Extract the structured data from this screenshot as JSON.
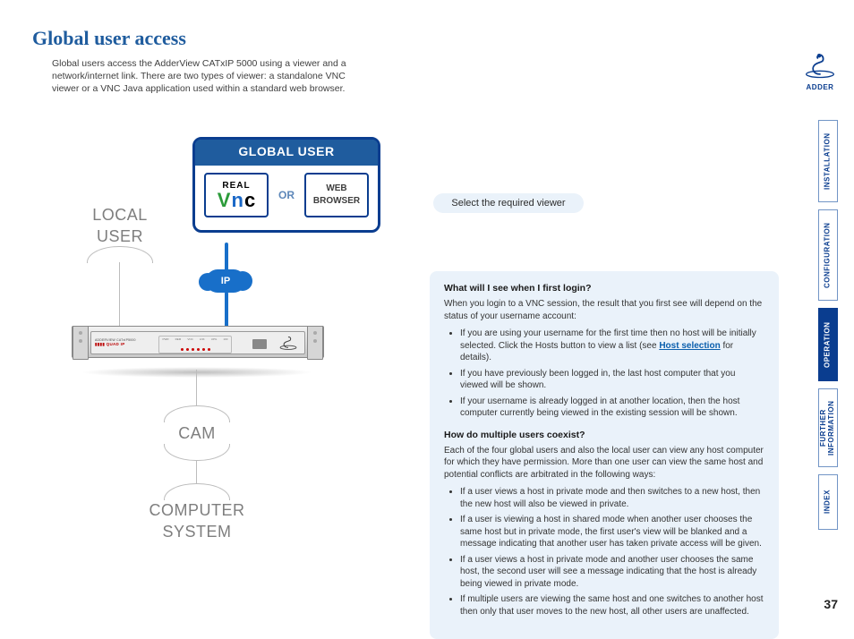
{
  "page_number": "37",
  "brand": "ADDER",
  "title": "Global user access",
  "intro": "Global users access the AdderView CATxIP 5000 using a viewer and a network/internet link. There are two types of viewer: a standalone VNC viewer or a VNC Java application used within a standard web browser.",
  "viewer_hint": "Select the required viewer",
  "diagram": {
    "global_user_title": "GLOBAL USER",
    "or_label": "OR",
    "vnc_real": "REAL",
    "web_browser_l1": "WEB",
    "web_browser_l2": "BROWSER",
    "ip_label": "IP",
    "local_user_l1": "LOCAL",
    "local_user_l2": "USER",
    "cam_label": "CAM",
    "computer_system_l1": "COMPUTER",
    "computer_system_l2": "SYSTEM",
    "device_leds": [
      "PWR",
      "REM",
      "VNC",
      "LNK",
      "UPG",
      "100"
    ],
    "device_quad": "QUAD IP",
    "device_model": "ADDERVIEW CATxIP5000"
  },
  "info": {
    "q1_title": "What will I see when I first login?",
    "q1_lead": "When you login to a VNC session, the result that you first see will depend on the status of your username account:",
    "q1_bullets": [
      {
        "pre": "If you are using your username for the first time then no host will be initially selected. Click the Hosts button to view a list (see ",
        "link": "Host selection",
        "post": " for details)."
      },
      {
        "text": "If you have previously been logged in, the last host computer that you viewed will be shown."
      },
      {
        "text": "If your username is already logged in at another location, then the host computer currently being viewed in the existing session will be shown."
      }
    ],
    "q2_title": "How do multiple users coexist?",
    "q2_lead": "Each of the four global users and also the local user can view any host computer for which they have permission. More than one user can view the same host and potential conflicts are arbitrated in the following ways:",
    "q2_bullets": [
      "If a user views a host in private mode and then switches to a new host, then the new host will also be viewed in private.",
      "If a user is viewing a host in shared mode when another user chooses the same host but in private mode, the first user's view will be blanked and a message indicating that another user has taken private access will be given.",
      "If a user views a host in private mode and another user chooses the same host, the second user will see a message indicating that the host is already being viewed in private mode.",
      "If multiple users are viewing the same host and one switches to another host then only that user moves to the new host, all other users are unaffected."
    ]
  },
  "nav": {
    "installation": "INSTALLATION",
    "configuration": "CONFIGURATION",
    "operation": "OPERATION",
    "further_l1": "FURTHER",
    "further_l2": "INFORMATION",
    "index": "INDEX"
  }
}
